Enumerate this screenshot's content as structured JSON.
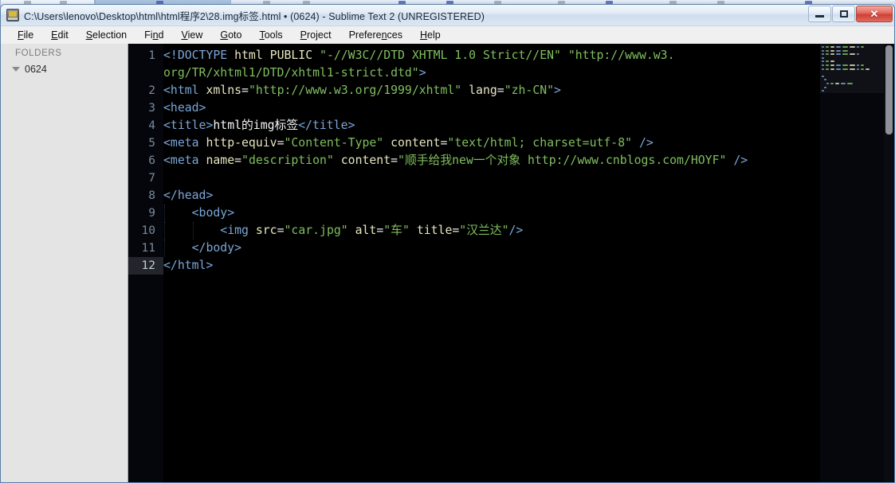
{
  "window": {
    "title": "C:\\Users\\lenovo\\Desktop\\html\\html程序2\\28.img标签.html • (0624) - Sublime Text 2 (UNREGISTERED)",
    "app_icon": "sublime-text-icon",
    "controls": {
      "minimize": "minimize-glyph",
      "maximize": "maximize-glyph",
      "close": "✕"
    }
  },
  "menubar": {
    "items": [
      {
        "label": "File",
        "accel": "F"
      },
      {
        "label": "Edit",
        "accel": "E"
      },
      {
        "label": "Selection",
        "accel": "S"
      },
      {
        "label": "Find",
        "accel": "n"
      },
      {
        "label": "View",
        "accel": "V"
      },
      {
        "label": "Goto",
        "accel": "G"
      },
      {
        "label": "Tools",
        "accel": "T"
      },
      {
        "label": "Project",
        "accel": "P"
      },
      {
        "label": "Preferences",
        "accel": "n"
      },
      {
        "label": "Help",
        "accel": "H"
      }
    ]
  },
  "sidebar": {
    "header": "FOLDERS",
    "folders": [
      {
        "label": "0624",
        "expanded": true,
        "disclosure": "triangle-down-icon"
      }
    ]
  },
  "editor": {
    "active_line": 12,
    "gutter_numbers": [
      "1",
      "",
      "2",
      "3",
      "4",
      "5",
      "6",
      "7",
      "8",
      "9",
      "10",
      "11",
      "12"
    ],
    "lines": [
      {
        "num": 1,
        "text": "<!DOCTYPE html PUBLIC \"-//W3C//DTD XHTML 1.0 Strict//EN\" \"http://www.w3."
      },
      {
        "num": "",
        "text": "org/TR/xhtml1/DTD/xhtml1-strict.dtd\">",
        "continuation": true
      },
      {
        "num": 2,
        "text": "<html xmlns=\"http://www.w3.org/1999/xhtml\" lang=\"zh-CN\">"
      },
      {
        "num": 3,
        "text": "<head>"
      },
      {
        "num": 4,
        "text": "<title>html的img标签</title>"
      },
      {
        "num": 5,
        "text": "<meta http-equiv=\"Content-Type\" content=\"text/html; charset=utf-8\" />"
      },
      {
        "num": 6,
        "text": "<meta name=\"description\" content=\"顺手给我new一个对象 http://www.cnblogs.com/HOYF\" />"
      },
      {
        "num": 7,
        "text": ""
      },
      {
        "num": 8,
        "text": "</head>"
      },
      {
        "num": 9,
        "text": "    <body>"
      },
      {
        "num": 10,
        "text": "        <img src=\"car.jpg\" alt=\"车\" title=\"汉兰达\"/>"
      },
      {
        "num": 11,
        "text": "    </body>"
      },
      {
        "num": 12,
        "text": "</html>"
      }
    ],
    "colors": {
      "background": "#000000",
      "gutter_background": "#04060c",
      "line_number": "#7d8a99",
      "active_line_number": "#c3ccd6",
      "tag": "#7aa6d8",
      "attribute": "#e8e6c0",
      "string": "#7fbf5e",
      "text": "#f4f6f8"
    }
  },
  "minimap": {
    "name": "code-minimap",
    "viewport_visible": true
  },
  "scrollbar": {
    "name": "vertical-scrollbar",
    "thumb_visible": true
  },
  "theme": {
    "sidebar_background": "#e4e4e4",
    "chrome_background": "#f0f0f0",
    "titlebar_accent": "#cfdded",
    "close_button": "#cf4034"
  }
}
